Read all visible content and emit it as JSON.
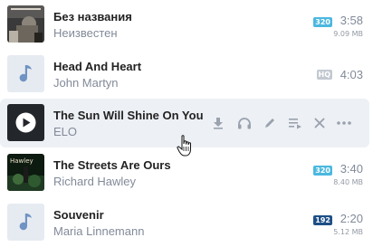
{
  "colors": {
    "accent": "#4bb8e0",
    "hover_row": "#edf0f5",
    "secondary_text": "#828a99",
    "icon_gray": "#99a2ad"
  },
  "tracks": [
    {
      "title": "Без названия",
      "artist": "Неизвестен",
      "quality": "320",
      "quality_color": "#4bb8e0",
      "duration": "3:58",
      "size": "9.09 MB",
      "cover": "album-art"
    },
    {
      "title": "Head And Heart",
      "artist": "John Martyn",
      "quality": "HQ",
      "quality_color": "#c3c9d1",
      "duration": "4:03",
      "cover": "music-note-placeholder"
    },
    {
      "title": "The Sun Will Shine On You",
      "artist": "ELO",
      "cover": "play-button",
      "state": "hovered",
      "actions": [
        "download-icon",
        "headphones-icon",
        "edit-icon",
        "add-to-queue-icon",
        "remove-icon",
        "more-icon"
      ]
    },
    {
      "title": "The Streets Are Ours",
      "artist": "Richard Hawley",
      "quality": "320",
      "quality_color": "#4bb8e0",
      "duration": "3:40",
      "size": "8.40 MB",
      "cover": "album-art"
    },
    {
      "title": "Souvenir",
      "artist": "Maria Linnemann",
      "quality": "192",
      "quality_color": "#1d4f86",
      "duration": "2:20",
      "size": "5.12 MB",
      "cover": "music-note-placeholder"
    }
  ]
}
